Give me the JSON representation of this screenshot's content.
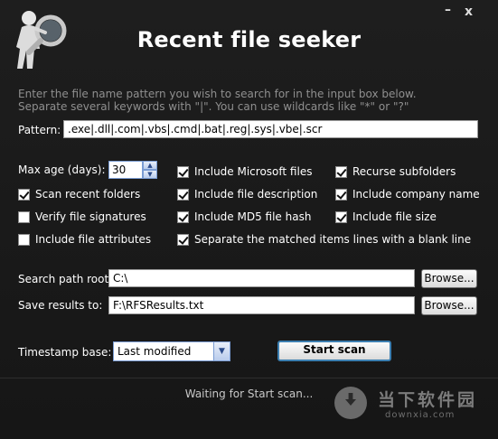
{
  "app": {
    "title": "Recent file seeker",
    "minimize_glyph": "–",
    "close_glyph": "x",
    "logo_icon": "magnifier-figure-icon"
  },
  "hint": {
    "line1": "Enter the file name pattern you wish to search for in the input box below.",
    "line2": "Separate several keywords with \"|\". You can use wildcards like \"*\" or \"?\""
  },
  "pattern": {
    "label": "Pattern:",
    "value": ".exe|.dll|.com|.vbs|.cmd|.bat|.reg|.sys|.vbe|.scr"
  },
  "max_age": {
    "label": "Max age (days):",
    "value": "30"
  },
  "options": {
    "include_microsoft_files": {
      "label": "Include Microsoft files",
      "checked": true
    },
    "recurse_subfolders": {
      "label": "Recurse subfolders",
      "checked": true
    },
    "scan_recent_folders": {
      "label": "Scan recent folders",
      "checked": true
    },
    "include_file_description": {
      "label": "Include file description",
      "checked": true
    },
    "include_company_name": {
      "label": "Include company name",
      "checked": true
    },
    "verify_file_signatures": {
      "label": "Verify file signatures",
      "checked": false
    },
    "include_md5_file_hash": {
      "label": "Include MD5 file hash",
      "checked": true
    },
    "include_file_size": {
      "label": "Include file size",
      "checked": true
    },
    "include_file_attributes": {
      "label": "Include file attributes",
      "checked": false
    },
    "separate_blank_line": {
      "label": "Separate the matched items lines with a blank line",
      "checked": true
    }
  },
  "search_path": {
    "label": "Search path root:",
    "value": "C:\\",
    "browse_label": "Browse..."
  },
  "save_results": {
    "label": "Save results to:",
    "value": "F:\\RFSResults.txt",
    "browse_label": "Browse..."
  },
  "timestamp": {
    "label": "Timestamp base:",
    "selected": "Last modified"
  },
  "start_button": {
    "label": "Start scan"
  },
  "status": {
    "text": "Waiting for Start scan..."
  },
  "watermark": {
    "cn": "当下软件园",
    "en": "downxia.com"
  }
}
